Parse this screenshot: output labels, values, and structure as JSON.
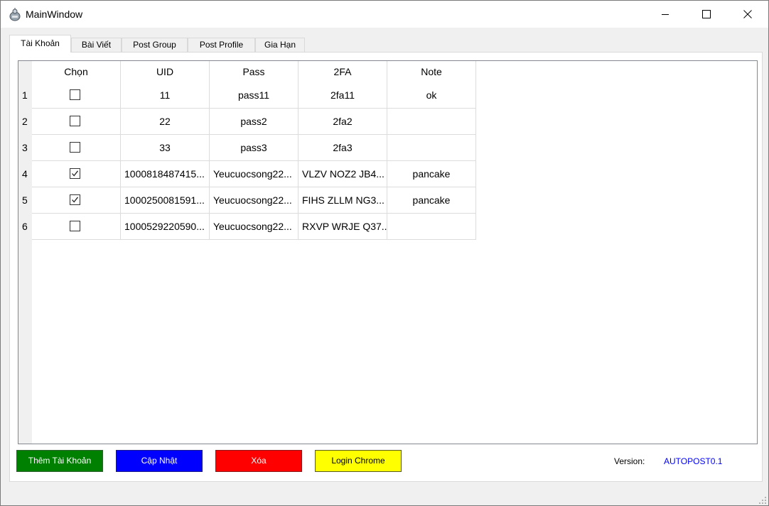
{
  "window": {
    "title": "MainWindow"
  },
  "tabs": [
    {
      "label": "Tài Khoản",
      "active": true
    },
    {
      "label": "Bài Viết",
      "active": false
    },
    {
      "label": "Post Group",
      "active": false
    },
    {
      "label": "Post Profile",
      "active": false
    },
    {
      "label": "Gia Hạn",
      "active": false
    }
  ],
  "table": {
    "columns": [
      "Chọn",
      "UID",
      "Pass",
      "2FA",
      "Note"
    ],
    "rows": [
      {
        "num": "1",
        "checked": false,
        "uid": "11",
        "pass": "pass11",
        "twofa": "2fa11",
        "note": "ok"
      },
      {
        "num": "2",
        "checked": false,
        "uid": "22",
        "pass": "pass2",
        "twofa": "2fa2",
        "note": ""
      },
      {
        "num": "3",
        "checked": false,
        "uid": "33",
        "pass": "pass3",
        "twofa": "2fa3",
        "note": ""
      },
      {
        "num": "4",
        "checked": true,
        "uid": "1000818487415...",
        "pass": "Yeucuocsong22...",
        "twofa": "VLZV NOZ2 JB4...",
        "note": "pancake"
      },
      {
        "num": "5",
        "checked": true,
        "uid": "1000250081591...",
        "pass": "Yeucuocsong22...",
        "twofa": "FIHS ZLLM NG3...",
        "note": "pancake"
      },
      {
        "num": "6",
        "checked": false,
        "uid": "1000529220590...",
        "pass": "Yeucuocsong22...",
        "twofa": "RXVP WRJE Q37...",
        "note": ""
      }
    ]
  },
  "buttons": {
    "add_account": "Thêm Tài Khoản",
    "update": "Cập Nhật",
    "delete": "Xóa",
    "login_chrome": "Login Chrome"
  },
  "version": {
    "label": "Version:",
    "value": "AUTOPOST0.1"
  },
  "colors": {
    "green": "#008000",
    "blue": "#0000ff",
    "red": "#ff0000",
    "yellow": "#ffff00"
  }
}
